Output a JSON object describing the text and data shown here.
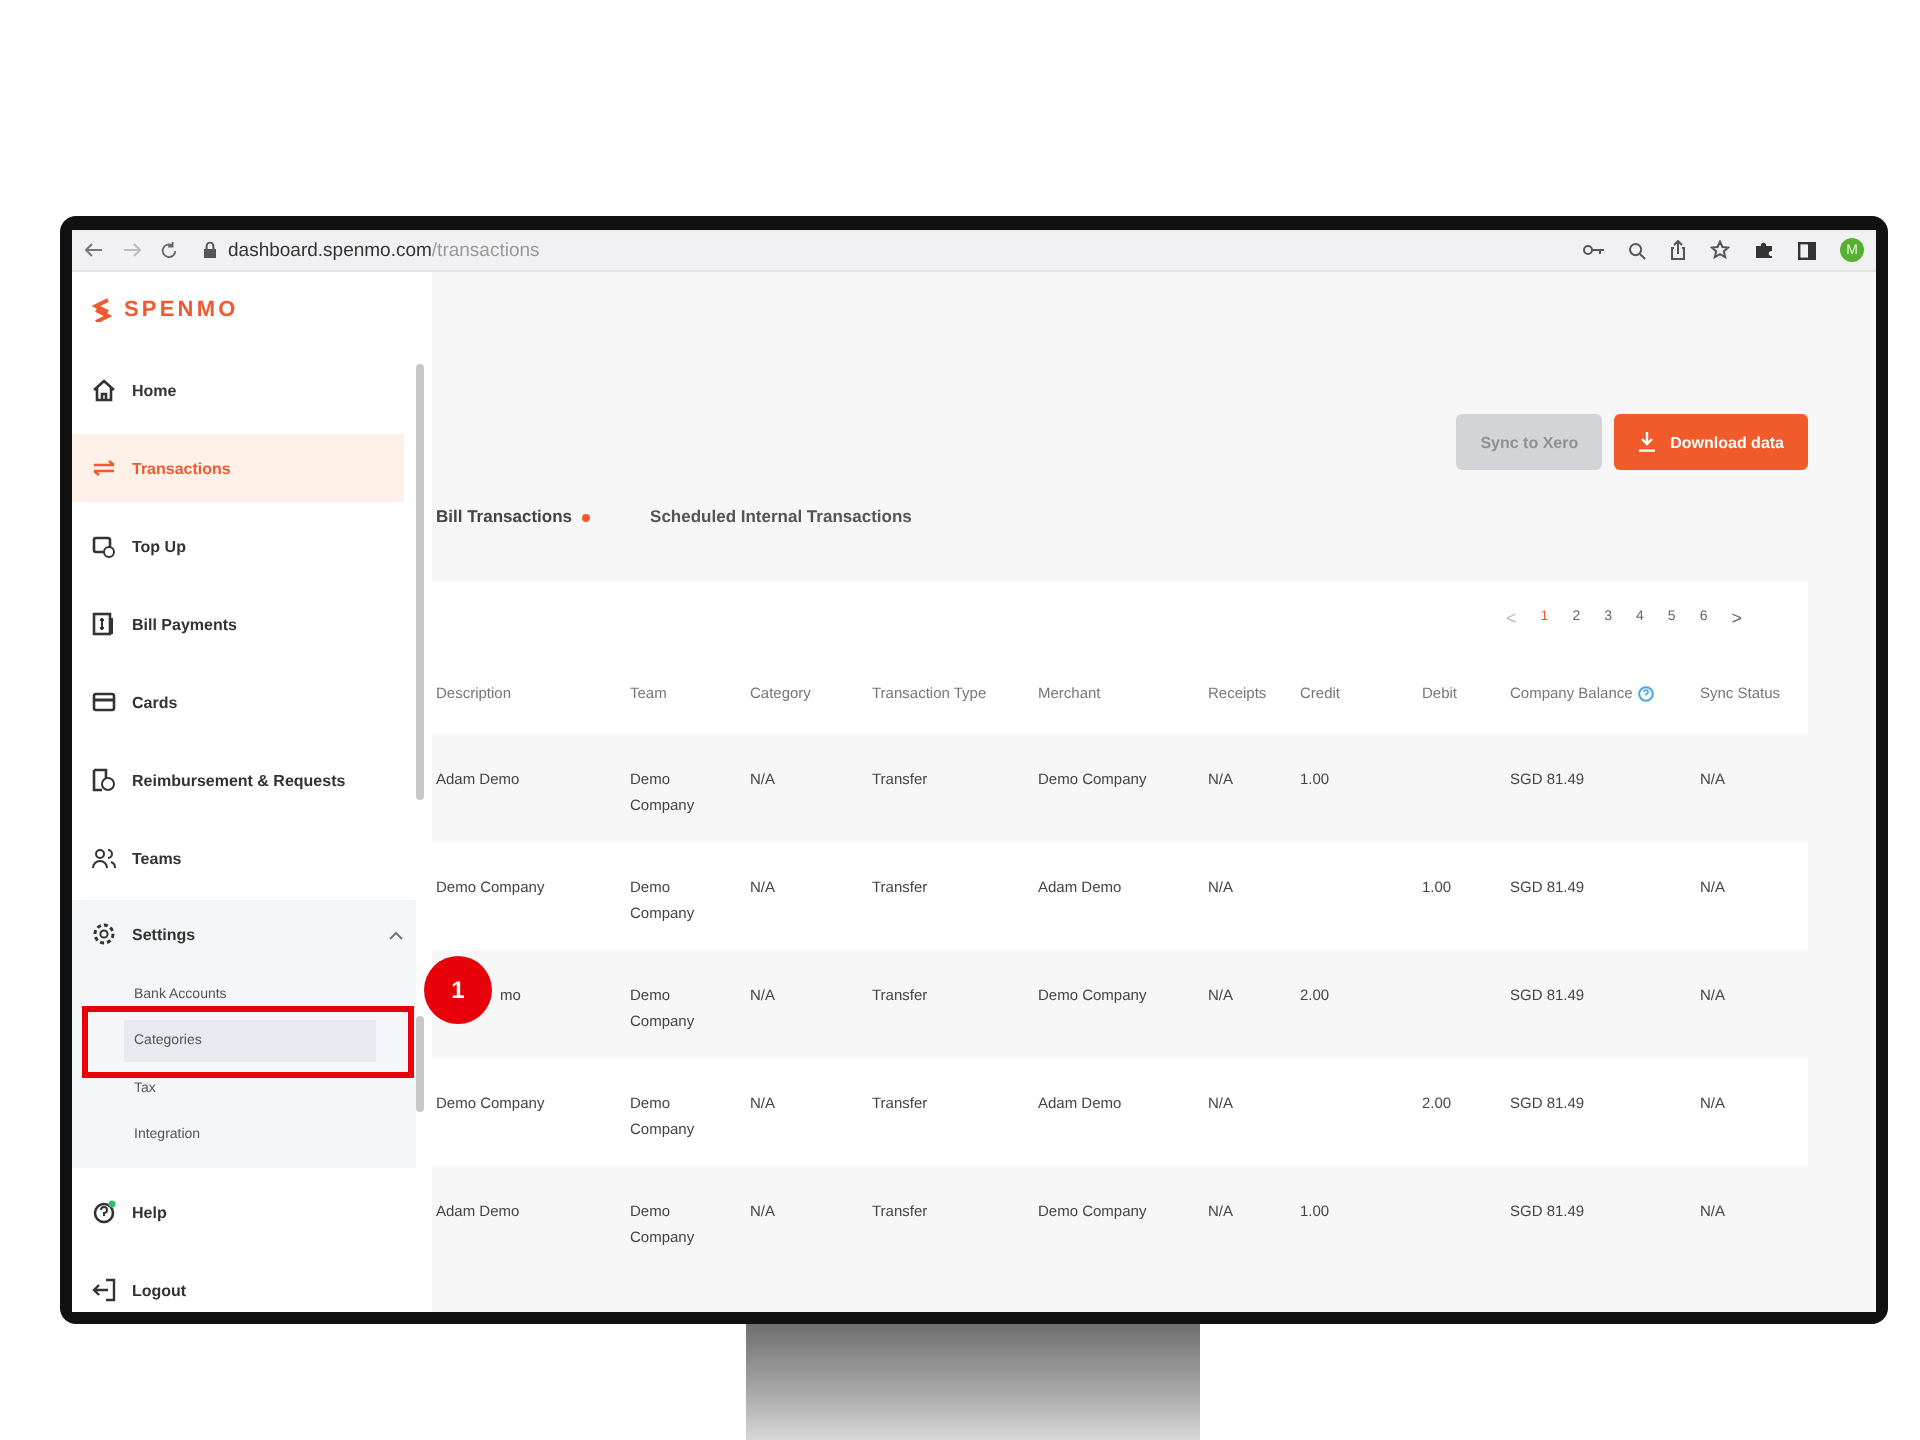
{
  "browser": {
    "url_host": "dashboard.spenmo.com",
    "url_path": "/transactions",
    "avatar": "M"
  },
  "sidebar": {
    "logo": "SPENMO",
    "items": [
      {
        "label": "Home",
        "selected": false
      },
      {
        "label": "Transactions",
        "selected": true
      },
      {
        "label": "Top Up",
        "selected": false
      },
      {
        "label": "Bill Payments",
        "selected": false
      },
      {
        "label": "Cards",
        "selected": false
      },
      {
        "label": "Reimbursement & Requests",
        "selected": false
      },
      {
        "label": "Teams",
        "selected": false
      },
      {
        "label": "Settings",
        "selected": false,
        "expanded": true,
        "children": [
          {
            "label": "Bank Accounts",
            "selected": false
          },
          {
            "label": "Categories",
            "selected": true
          },
          {
            "label": "Tax",
            "selected": false
          },
          {
            "label": "Integration",
            "selected": false
          }
        ]
      },
      {
        "label": "Help",
        "selected": false
      },
      {
        "label": "Logout",
        "selected": false
      }
    ]
  },
  "buttons": [
    {
      "label": "Sync to Xero",
      "kind": "secondary",
      "disabled": true
    },
    {
      "label": "Download data",
      "kind": "primary",
      "disabled": false
    }
  ],
  "tabs": [
    {
      "label": "Bill Transactions",
      "selected": true
    },
    {
      "label": "Scheduled Internal Transactions",
      "selected": false
    }
  ],
  "pagination": {
    "prev": "<",
    "next": ">",
    "pages": [
      {
        "label": "1",
        "selected": true
      },
      {
        "label": "2",
        "selected": false
      },
      {
        "label": "3",
        "selected": false
      },
      {
        "label": "4",
        "selected": false
      },
      {
        "label": "5",
        "selected": false
      },
      {
        "label": "6",
        "selected": false
      }
    ]
  },
  "table": {
    "columns": [
      "Description",
      "Team",
      "Category",
      "Transaction Type",
      "Merchant",
      "Receipts",
      "Credit",
      "Debit",
      "Company Balance",
      "Sync Status"
    ],
    "rows": [
      {
        "cells": [
          "Adam Demo",
          "Demo Company",
          "N/A",
          "Transfer",
          "Demo Company",
          "N/A",
          "1.00",
          "",
          "SGD 81.49",
          "N/A"
        ],
        "covered": false
      },
      {
        "cells": [
          "Demo Company",
          "Demo Company",
          "N/A",
          "Transfer",
          "Adam Demo",
          "N/A",
          "",
          "1.00",
          "SGD 81.49",
          "N/A"
        ],
        "covered": false
      },
      {
        "cells": [
          "mo",
          "Demo Company",
          "N/A",
          "Transfer",
          "Demo Company",
          "N/A",
          "2.00",
          "",
          "SGD 81.49",
          "N/A"
        ],
        "covered": true
      },
      {
        "cells": [
          "Demo Company",
          "Demo Company",
          "N/A",
          "Transfer",
          "Adam Demo",
          "N/A",
          "",
          "2.00",
          "SGD 81.49",
          "N/A"
        ],
        "covered": false
      },
      {
        "cells": [
          "Adam Demo",
          "Demo Company",
          "N/A",
          "Transfer",
          "Demo Company",
          "N/A",
          "1.00",
          "",
          "SGD 81.49",
          "N/A"
        ],
        "covered": false
      }
    ]
  },
  "annotation": {
    "marker": "1"
  }
}
